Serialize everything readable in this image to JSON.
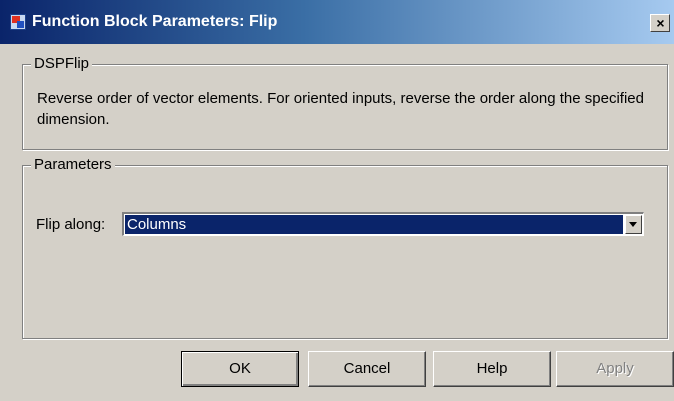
{
  "window": {
    "title": "Function Block Parameters: Flip",
    "close_label": "×"
  },
  "block": {
    "group_label": "DSPFlip",
    "description": "Reverse order of vector elements. For oriented inputs, reverse the order along the specified dimension."
  },
  "parameters": {
    "group_label": "Parameters",
    "flip_along_label": "Flip along:",
    "flip_along_value": "Columns"
  },
  "buttons": {
    "ok": "OK",
    "cancel": "Cancel",
    "help": "Help",
    "apply": "Apply"
  },
  "icons": {
    "app": "simulink-block-icon",
    "close": "close-icon",
    "dropdown": "chevron-down-icon"
  },
  "colors": {
    "title_start": "#0a246a",
    "title_end": "#a6caf0",
    "selection": "#0a246a",
    "face": "#d4d0c8"
  }
}
